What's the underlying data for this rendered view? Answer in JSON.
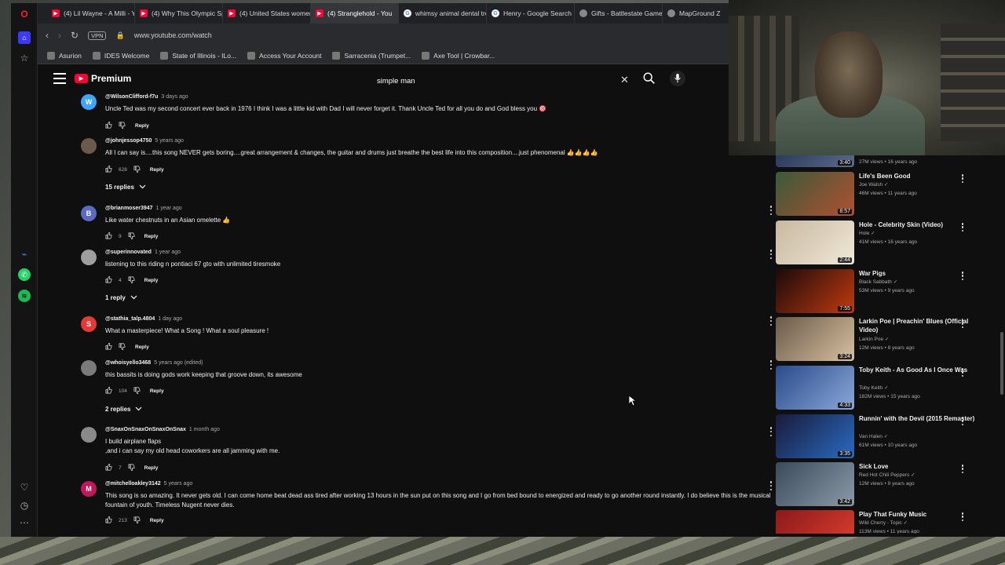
{
  "tabs": [
    {
      "label": "(4) Lil Wayne - A Milli - Yo",
      "icon": "youtube"
    },
    {
      "label": "(4) Why This Olympic Spo",
      "icon": "youtube"
    },
    {
      "label": "(4) United States women'",
      "icon": "youtube"
    },
    {
      "label": "(4) Stranglehold - You",
      "icon": "youtube",
      "active": true
    },
    {
      "label": "whimsy animal dental tre",
      "icon": "google"
    },
    {
      "label": "Henry - Google Search",
      "icon": "google"
    },
    {
      "label": "Gifts - Battlestate Games",
      "icon": "generic"
    },
    {
      "label": "MapGround Z",
      "icon": "generic"
    }
  ],
  "address": {
    "vpn": "VPN",
    "url": "www.youtube.com/watch"
  },
  "bookmarks": [
    "Asurion",
    "IDES Welcome",
    "State of Illinois - ILo...",
    "Access Your Account",
    "Sarracenia (Trumpet...",
    "Axe Tool | Crowbar..."
  ],
  "youtube": {
    "logo": "Premium",
    "search_value": "simple man"
  },
  "comments": [
    {
      "initial": "W",
      "color": "#3ea6ff",
      "handle": "@WilsonClifford-f7u",
      "time": "3 days ago",
      "text": "Uncle Ted was my second concert ever back in 1976 I think I was a little kid with Dad I will never forget it. Thank Uncle Ted for all you do and God bless you 🎯",
      "likes": "",
      "reply": "Reply"
    },
    {
      "initial": "",
      "color": "#6b5a4a",
      "handle": "@johnjessop4750",
      "time": "5 years ago",
      "text": "All I can say is....this song NEVER gets boring....great arrangement & changes, the guitar and drums just breathe the best life into this composition....just phenomenal 👍👍👍👍",
      "likes": "628",
      "reply": "Reply",
      "replies": "15 replies"
    },
    {
      "initial": "B",
      "color": "#5c6bc0",
      "handle": "@brianmoser3947",
      "time": "1 year ago",
      "text": "Like water chestnuts in an Asian omelette 👍",
      "likes": "9",
      "reply": "Reply"
    },
    {
      "initial": "",
      "color": "#9e9e9e",
      "handle": "@superinnovated",
      "time": "1 year ago",
      "text": "listening to this riding n  pontiaci 67 gto    with unlimited tiresmoke",
      "likes": "4",
      "reply": "Reply",
      "replies": "1 reply"
    },
    {
      "initial": "S",
      "color": "#e53935",
      "handle": "@stathia_talp.4804",
      "time": "1 day ago",
      "text": "What a masterpiece! What a Song ! What a soul pleasure !",
      "likes": "",
      "reply": "Reply"
    },
    {
      "initial": "",
      "color": "#7a7a7a",
      "handle": "@whoisyello3468",
      "time": "5 years ago (edited)",
      "text": "this bassits is doing gods work keeping that groove down, its awesome",
      "likes": "104",
      "reply": "Reply",
      "replies": "2 replies"
    },
    {
      "initial": "",
      "color": "#8a8a8a",
      "handle": "@SnaxOnSnaxOnSnaxOnSnax",
      "time": "1 month ago",
      "text": "I build airplane flaps\n,and i can say my old head coworkers are all jamming with me.",
      "likes": "7",
      "reply": "Reply"
    },
    {
      "initial": "M",
      "color": "#c2185b",
      "handle": "@mitchelloakley3142",
      "time": "5 years ago",
      "text": "This song is so amazing.  It never gets old.  I can come home beat dead ass tired after working 13 hours in the sun put on this song and I go from bed bound to energized and ready to go another round instantly.  I do believe this is the musical fountain of youth. Timeless Nugent never dies.",
      "likes": "213",
      "reply": "Reply"
    }
  ],
  "recommendations": [
    {
      "title": "",
      "channel": "",
      "meta": "27M views • 16 years ago",
      "duration": "3:40",
      "colors": [
        "#1c2a4a",
        "#5a6a8a"
      ]
    },
    {
      "title": "Life's Been Good",
      "channel": "Joe Walsh",
      "meta": "46M views • 11 years ago",
      "duration": "8:57",
      "colors": [
        "#3a5a3a",
        "#b05030"
      ]
    },
    {
      "title": "Hole - Celebrity Skin (Video)",
      "channel": "Hole",
      "meta": "41M views • 16 years ago",
      "duration": "2:44",
      "colors": [
        "#c8b8a0",
        "#f0e8d8"
      ]
    },
    {
      "title": "War Pigs",
      "channel": "Black Sabbath",
      "meta": "53M views • 9 years ago",
      "duration": "7:55",
      "colors": [
        "#1a0a0a",
        "#c03a10"
      ]
    },
    {
      "title": "Larkin Poe | Preachin' Blues (Official Video)",
      "channel": "Larkin Poe",
      "meta": "12M views • 8 years ago",
      "duration": "3:24",
      "colors": [
        "#6a5a4a",
        "#d8c0a0"
      ]
    },
    {
      "title": "Toby Keith - As Good As I Once Was",
      "channel": "Toby Keith",
      "meta": "182M views • 15 years ago",
      "duration": "4:33",
      "colors": [
        "#2a4a8a",
        "#8aa8d8"
      ]
    },
    {
      "title": "Runnin' with the Devil (2015 Remaster)",
      "channel": "Van Halen",
      "meta": "61M views • 10 years ago",
      "duration": "3:35",
      "colors": [
        "#1a1a3a",
        "#2a6ac0"
      ]
    },
    {
      "title": "Sick Love",
      "channel": "Red Hot Chili Peppers",
      "meta": "12M views • 9 years ago",
      "duration": "3:42",
      "colors": [
        "#3a4a5a",
        "#8a9aa8"
      ]
    },
    {
      "title": "Play That Funky Music",
      "channel": "Wild Cherry - Topic",
      "meta": "113M views • 11 years ago",
      "duration": "",
      "colors": [
        "#8a1a1a",
        "#e04030"
      ]
    }
  ]
}
